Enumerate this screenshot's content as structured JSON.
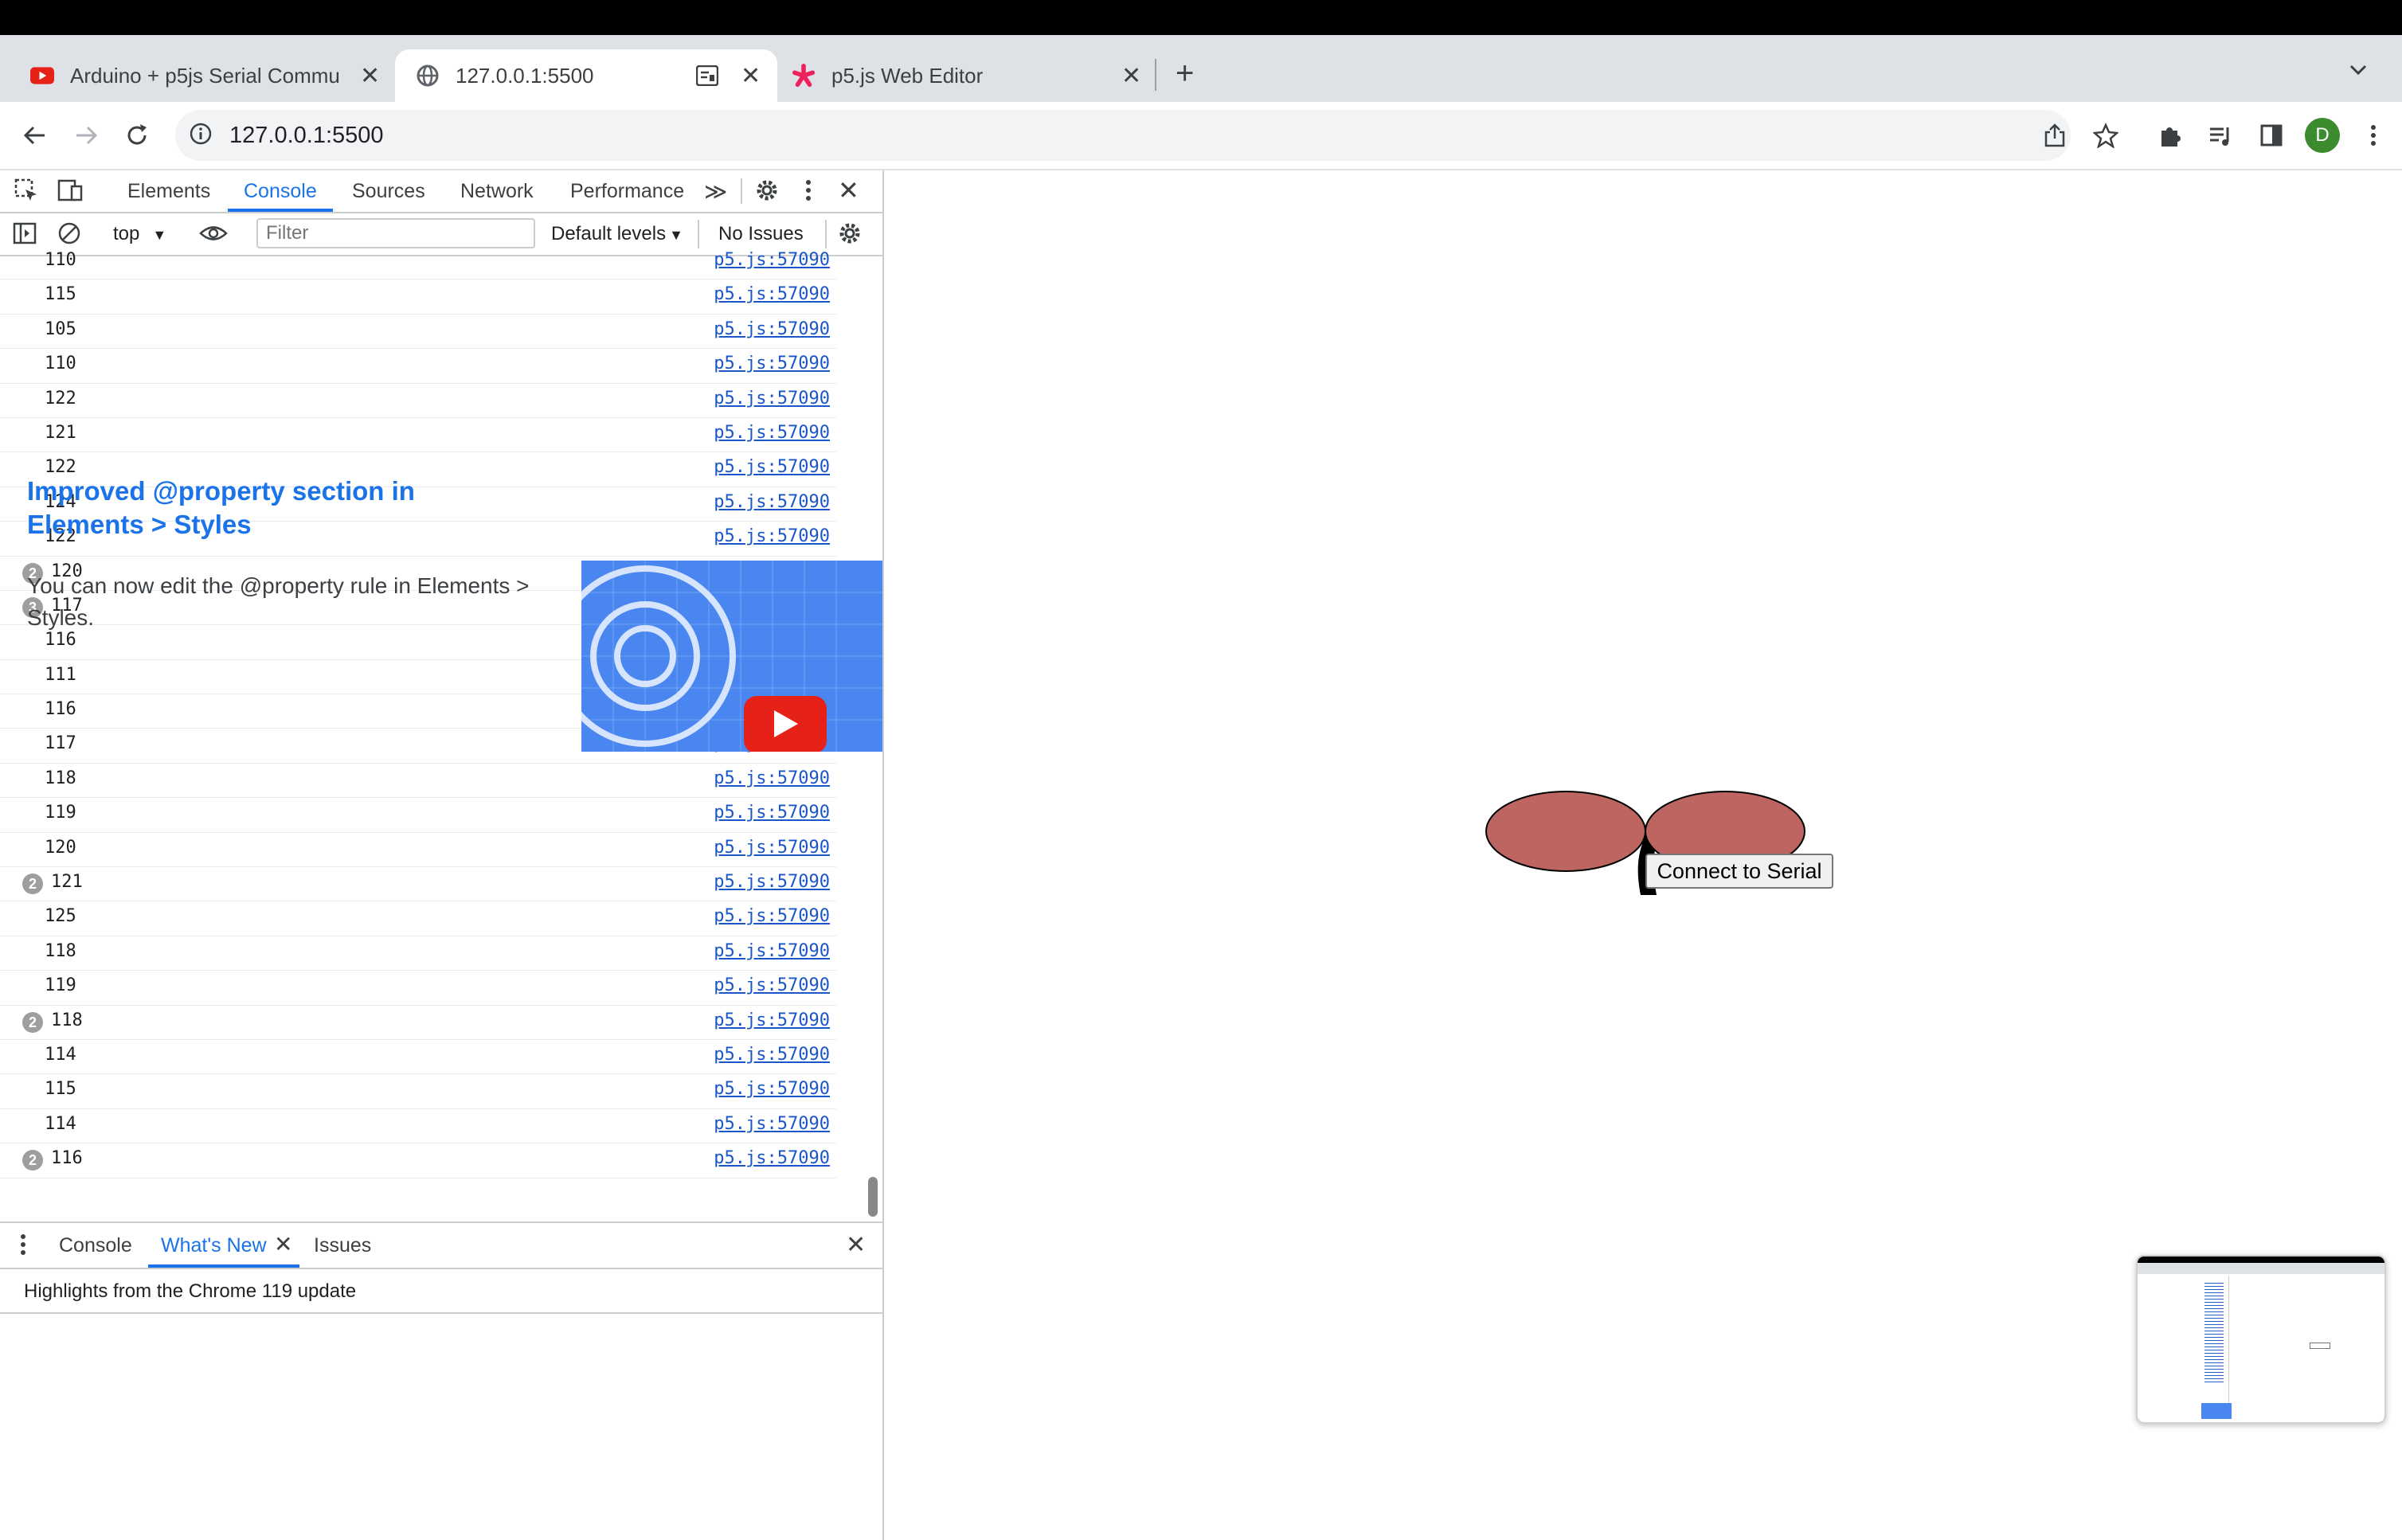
{
  "browser": {
    "tabs": [
      {
        "title": "Arduino + p5js Serial Commun",
        "favicon": "youtube-icon"
      },
      {
        "title": "127.0.0.1:5500",
        "favicon": "globe-icon"
      },
      {
        "title": "p5.js Web Editor",
        "favicon": "p5-asterisk-icon"
      }
    ],
    "url": "127.0.0.1:5500",
    "profile_initial": "D",
    "colors": {
      "tabstrip": "#dee1e6",
      "profile": "#3d8b2f",
      "youtube": "#e62117",
      "p5": "#ed225d"
    }
  },
  "devtools": {
    "tabs": [
      "Elements",
      "Console",
      "Sources",
      "Network",
      "Performance"
    ],
    "active_tab": "Console",
    "context": "top",
    "filter_placeholder": "Filter",
    "levels": "Default levels",
    "issues": "No Issues",
    "log": [
      {
        "value": "110",
        "count": null,
        "source": "p5.js:57090"
      },
      {
        "value": "115",
        "count": null,
        "source": "p5.js:57090"
      },
      {
        "value": "105",
        "count": null,
        "source": "p5.js:57090"
      },
      {
        "value": "110",
        "count": null,
        "source": "p5.js:57090"
      },
      {
        "value": "122",
        "count": null,
        "source": "p5.js:57090"
      },
      {
        "value": "121",
        "count": null,
        "source": "p5.js:57090"
      },
      {
        "value": "122",
        "count": null,
        "source": "p5.js:57090"
      },
      {
        "value": "124",
        "count": null,
        "source": "p5.js:57090"
      },
      {
        "value": "122",
        "count": null,
        "source": "p5.js:57090"
      },
      {
        "value": "120",
        "count": "2",
        "source": "p5.js:57090"
      },
      {
        "value": "117",
        "count": "3",
        "source": "p5.js:57090"
      },
      {
        "value": "116",
        "count": null,
        "source": "p5.js:57090"
      },
      {
        "value": "111",
        "count": null,
        "source": "p5.js:57090"
      },
      {
        "value": "116",
        "count": null,
        "source": "p5.js:57090"
      },
      {
        "value": "117",
        "count": null,
        "source": "p5.js:57090"
      },
      {
        "value": "118",
        "count": null,
        "source": "p5.js:57090"
      },
      {
        "value": "119",
        "count": null,
        "source": "p5.js:57090"
      },
      {
        "value": "120",
        "count": null,
        "source": "p5.js:57090"
      },
      {
        "value": "121",
        "count": "2",
        "source": "p5.js:57090"
      },
      {
        "value": "125",
        "count": null,
        "source": "p5.js:57090"
      },
      {
        "value": "118",
        "count": null,
        "source": "p5.js:57090"
      },
      {
        "value": "119",
        "count": null,
        "source": "p5.js:57090"
      },
      {
        "value": "118",
        "count": "2",
        "source": "p5.js:57090"
      },
      {
        "value": "114",
        "count": null,
        "source": "p5.js:57090"
      },
      {
        "value": "115",
        "count": null,
        "source": "p5.js:57090"
      },
      {
        "value": "114",
        "count": null,
        "source": "p5.js:57090"
      },
      {
        "value": "116",
        "count": "2",
        "source": "p5.js:57090"
      }
    ],
    "drawer": {
      "tabs": [
        "Console",
        "What's New",
        "Issues"
      ],
      "active_tab": "What's New",
      "highlight": "Highlights from the Chrome 119 update",
      "feature_title": "Improved @property section in Elements > Styles",
      "feature_desc": "You can now edit the @property rule in Elements > Styles."
    }
  },
  "page": {
    "button_label": "Connect to Serial",
    "ellipse_fill": "#bd6661"
  }
}
